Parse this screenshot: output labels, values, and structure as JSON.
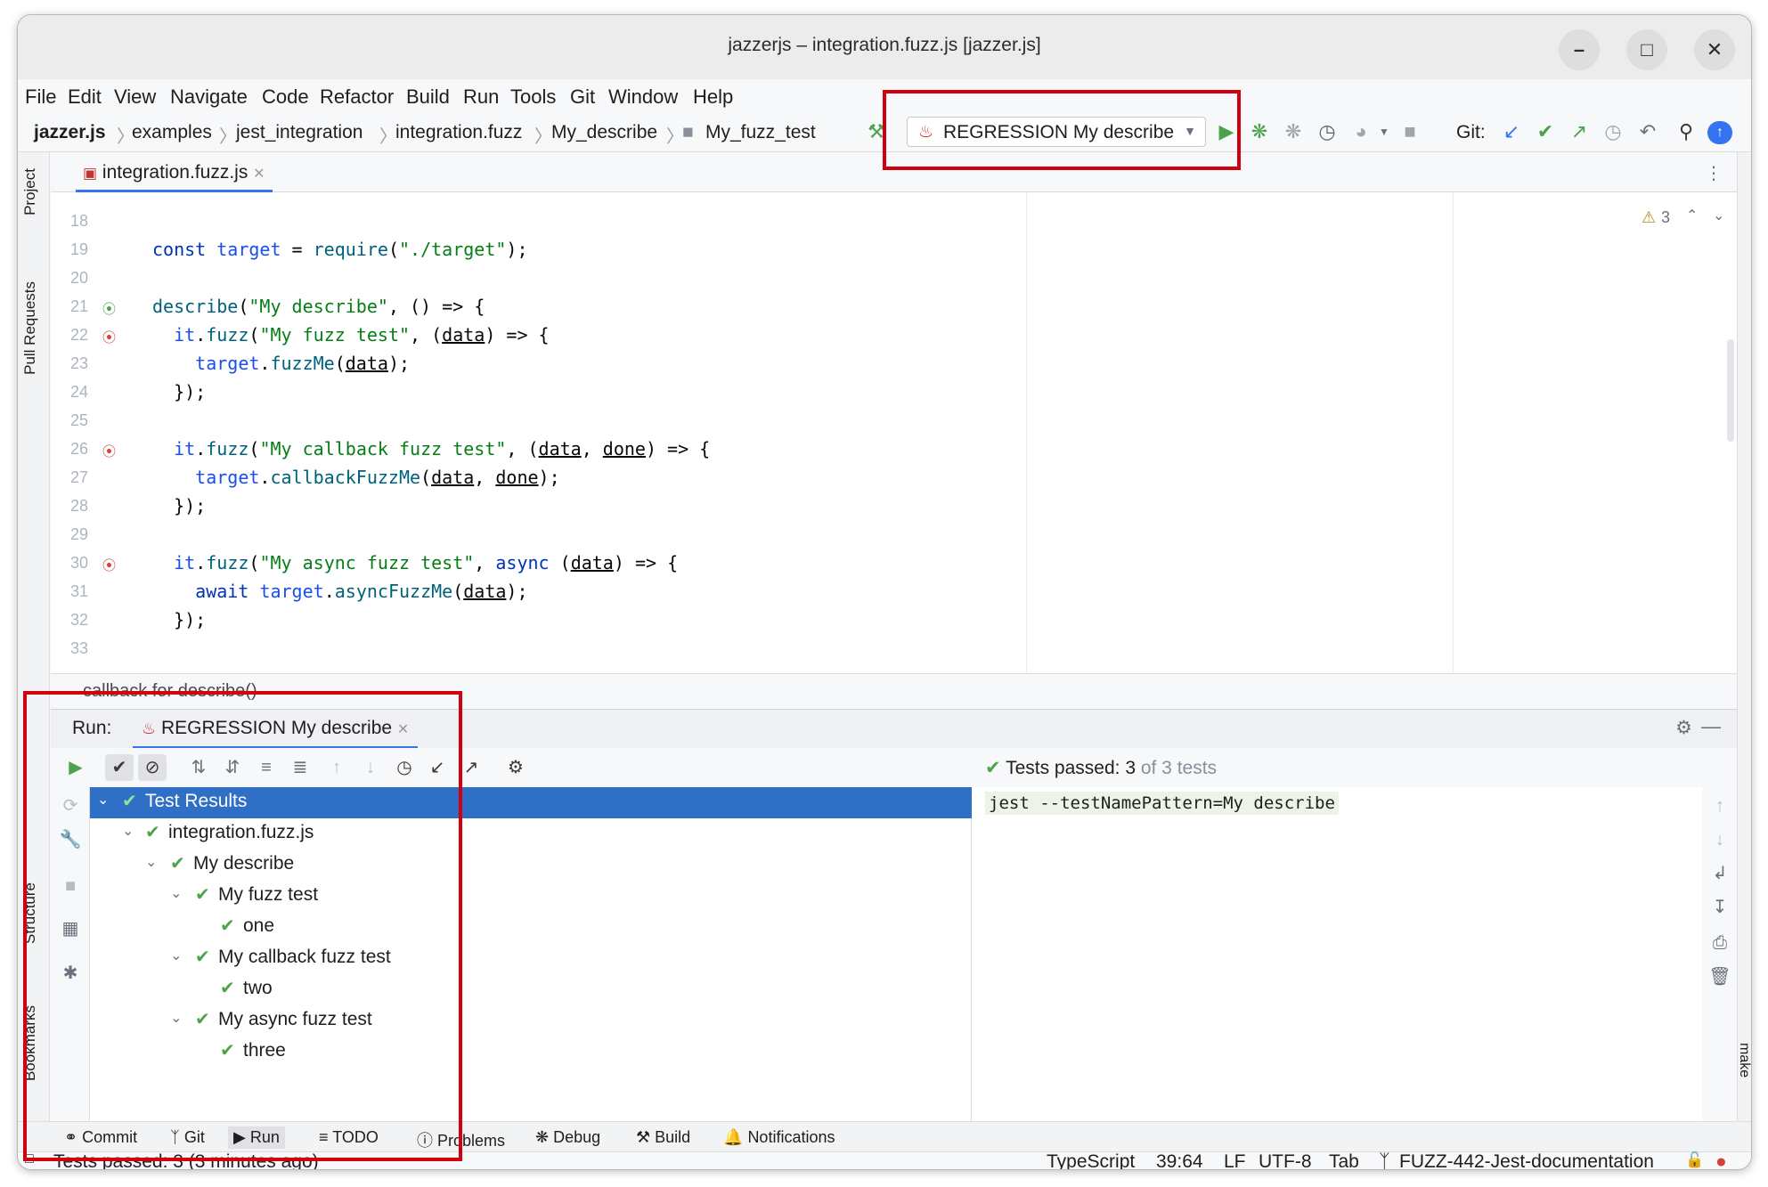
{
  "window": {
    "title": "jazzerjs – integration.fuzz.js [jazzer.js]",
    "controls": [
      "minimize",
      "maximize",
      "close"
    ]
  },
  "menu": [
    "File",
    "Edit",
    "View",
    "Navigate",
    "Code",
    "Refactor",
    "Build",
    "Run",
    "Tools",
    "Git",
    "Window",
    "Help"
  ],
  "breadcrumbs": [
    "jazzer.js",
    "examples",
    "jest_integration",
    "integration.fuzz",
    "My_describe",
    "My_fuzz_test"
  ],
  "toolbar": {
    "run_config": "REGRESSION My describe",
    "git_label": "Git:"
  },
  "left_tool_tabs": [
    "Project",
    "Pull Requests",
    "Structure",
    "Bookmarks"
  ],
  "right_tool_tabs": [
    "make"
  ],
  "editor": {
    "tab": "integration.fuzz.js",
    "warnings": "3",
    "lines": [
      {
        "n": "18",
        "code": ""
      },
      {
        "n": "19",
        "code": "const target = require(\"./target\");"
      },
      {
        "n": "20",
        "code": ""
      },
      {
        "n": "21",
        "code": "describe(\"My describe\", () => {"
      },
      {
        "n": "22",
        "code": "  it.fuzz(\"My fuzz test\", (data) => {"
      },
      {
        "n": "23",
        "code": "    target.fuzzMe(data);"
      },
      {
        "n": "24",
        "code": "  });"
      },
      {
        "n": "25",
        "code": ""
      },
      {
        "n": "26",
        "code": "  it.fuzz(\"My callback fuzz test\", (data, done) => {"
      },
      {
        "n": "27",
        "code": "    target.callbackFuzzMe(data, done);"
      },
      {
        "n": "28",
        "code": "  });"
      },
      {
        "n": "29",
        "code": ""
      },
      {
        "n": "30",
        "code": "  it.fuzz(\"My async fuzz test\", async (data) => {"
      },
      {
        "n": "31",
        "code": "    await target.asyncFuzzMe(data);"
      },
      {
        "n": "32",
        "code": "  });"
      },
      {
        "n": "33",
        "code": ""
      }
    ],
    "breadcrumb": "callback for describe()"
  },
  "run": {
    "label": "Run:",
    "tab": "REGRESSION My describe",
    "summary_prefix": "Tests passed: ",
    "summary_count": "3",
    "summary_suffix": " of 3 tests",
    "console_line": "jest --testNamePattern=My describe",
    "tree": [
      {
        "label": "Test Results",
        "depth": 0,
        "expanded": true,
        "selected": true
      },
      {
        "label": "integration.fuzz.js",
        "depth": 1,
        "expanded": true
      },
      {
        "label": "My describe",
        "depth": 2,
        "expanded": true
      },
      {
        "label": "My fuzz test",
        "depth": 3,
        "expanded": true
      },
      {
        "label": "one",
        "depth": 4
      },
      {
        "label": "My callback fuzz test",
        "depth": 3,
        "expanded": true
      },
      {
        "label": "two",
        "depth": 4
      },
      {
        "label": "My async fuzz test",
        "depth": 3,
        "expanded": true
      },
      {
        "label": "three",
        "depth": 4
      }
    ]
  },
  "bottom_tabs": [
    "Commit",
    "Git",
    "Run",
    "TODO",
    "Problems",
    "Debug",
    "Build",
    "Notifications"
  ],
  "status": {
    "message": "Tests passed: 3 (3 minutes ago)",
    "language": "TypeScript",
    "position": "39:64",
    "line_ending": "LF",
    "encoding": "UTF-8",
    "indent": "Tab",
    "branch": "FUZZ-442-Jest-documentation"
  },
  "colors": {
    "accent": "#3574f0",
    "selection": "#2f6fc6",
    "pass": "#4ca34c",
    "highlight_box": "#d0000d"
  }
}
